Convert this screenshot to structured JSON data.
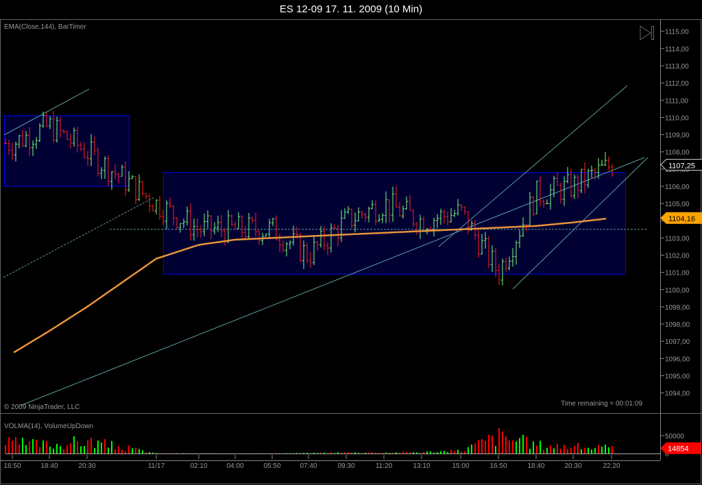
{
  "window": {
    "title": "ES 12-09  17. 11. 2009 (10 Min)"
  },
  "price_panel": {
    "indicator_label": "EMA(Close,144), BarTimer",
    "copyright": "© 2009 NinjaTrader, LLC",
    "time_remaining": "Time remaining = 00:01:09",
    "last_price_label": "1107,25",
    "ema_label": "1104,16",
    "scroll_end_icon": "skip-to-end-icon"
  },
  "volume_panel": {
    "indicator_label": "VOLMA(14), VolumeUpDown",
    "last_volume_label": "14854",
    "axis_labels": [
      "50000",
      "0"
    ]
  },
  "colors": {
    "up": "#00ff00",
    "down": "#ff0000",
    "ema": "#e8943a",
    "box_fill": "#000033",
    "box_border": "#0000ff",
    "trendline": "#5f9ea0",
    "ema_tag": "#ffa500"
  },
  "chart_data": {
    "type": "bar",
    "y_ticks": [
      "1115,00",
      "1114,00",
      "1113,00",
      "1112,00",
      "1111,00",
      "1110,00",
      "1109,00",
      "1108,00",
      "1107,00",
      "1106,00",
      "1105,00",
      "1104,00",
      "1103,00",
      "1102,00",
      "1101,00",
      "1100,00",
      "1099,00",
      "1098,00",
      "1097,00",
      "1096,00",
      "1095,00",
      "1094,00"
    ],
    "ylim": [
      1093.5,
      1115.5
    ],
    "x_ticks": [
      "16:50",
      "18:40",
      "20:30",
      "11/17",
      "02:10",
      "04:00",
      "05:50",
      "07:40",
      "09:30",
      "11:20",
      "13:10",
      "15:00",
      "16:50",
      "18:40",
      "20:30",
      "22:20"
    ],
    "close_at_ticks": [
      1108.5,
      1109.5,
      1108.0,
      1105.0,
      1103.5,
      1103.5,
      1103.5,
      1102.0,
      1104.0,
      1105.0,
      1104.0,
      1104.5,
      1101.0,
      1105.5,
      1106.0,
      1107.25
    ],
    "ema_at_ticks": [
      1096.3,
      1097.6,
      1099.0,
      1101.8,
      1102.6,
      1102.9,
      1103.0,
      1103.1,
      1103.2,
      1103.3,
      1103.4,
      1103.5,
      1103.6,
      1103.7,
      1103.9,
      1104.16
    ],
    "volume_at_ticks": [
      30000,
      25000,
      35000,
      800,
      500,
      400,
      300,
      1500,
      3000,
      2500,
      4000,
      8000,
      50000,
      25000,
      20000,
      14854
    ],
    "volume_ylim": [
      0,
      100000
    ]
  }
}
